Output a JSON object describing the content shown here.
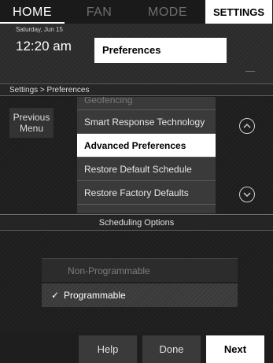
{
  "tabs": [
    {
      "label": "HOME"
    },
    {
      "label": "FAN"
    },
    {
      "label": "MODE"
    },
    {
      "label": "SETTINGS"
    }
  ],
  "header": {
    "date": "Saturday, Jun 15",
    "time": "12:20 am",
    "title": "Preferences"
  },
  "breadcrumb": "Settings > Preferences",
  "previous_menu": "Previous\nMenu",
  "menu": {
    "items": [
      {
        "label": "Geofencing"
      },
      {
        "label": "Smart Response Technology"
      },
      {
        "label": "Advanced Preferences",
        "selected": true
      },
      {
        "label": "Restore Default Schedule"
      },
      {
        "label": "Restore Factory Defaults"
      }
    ],
    "scroll_up_icon": "chevron-up-circle-icon",
    "scroll_down_icon": "chevron-down-circle-icon"
  },
  "scheduling": {
    "title": "Scheduling Options",
    "options": [
      {
        "label": "Non-Programmable",
        "checked": false
      },
      {
        "label": "Programmable",
        "checked": true
      }
    ],
    "check_glyph": "✓"
  },
  "buttons": {
    "help": "Help",
    "done": "Done",
    "next": "Next"
  },
  "colors": {
    "background": "#1e1e1e",
    "selected_bg": "#ffffff",
    "menu_bg": "#3a3a3a"
  }
}
